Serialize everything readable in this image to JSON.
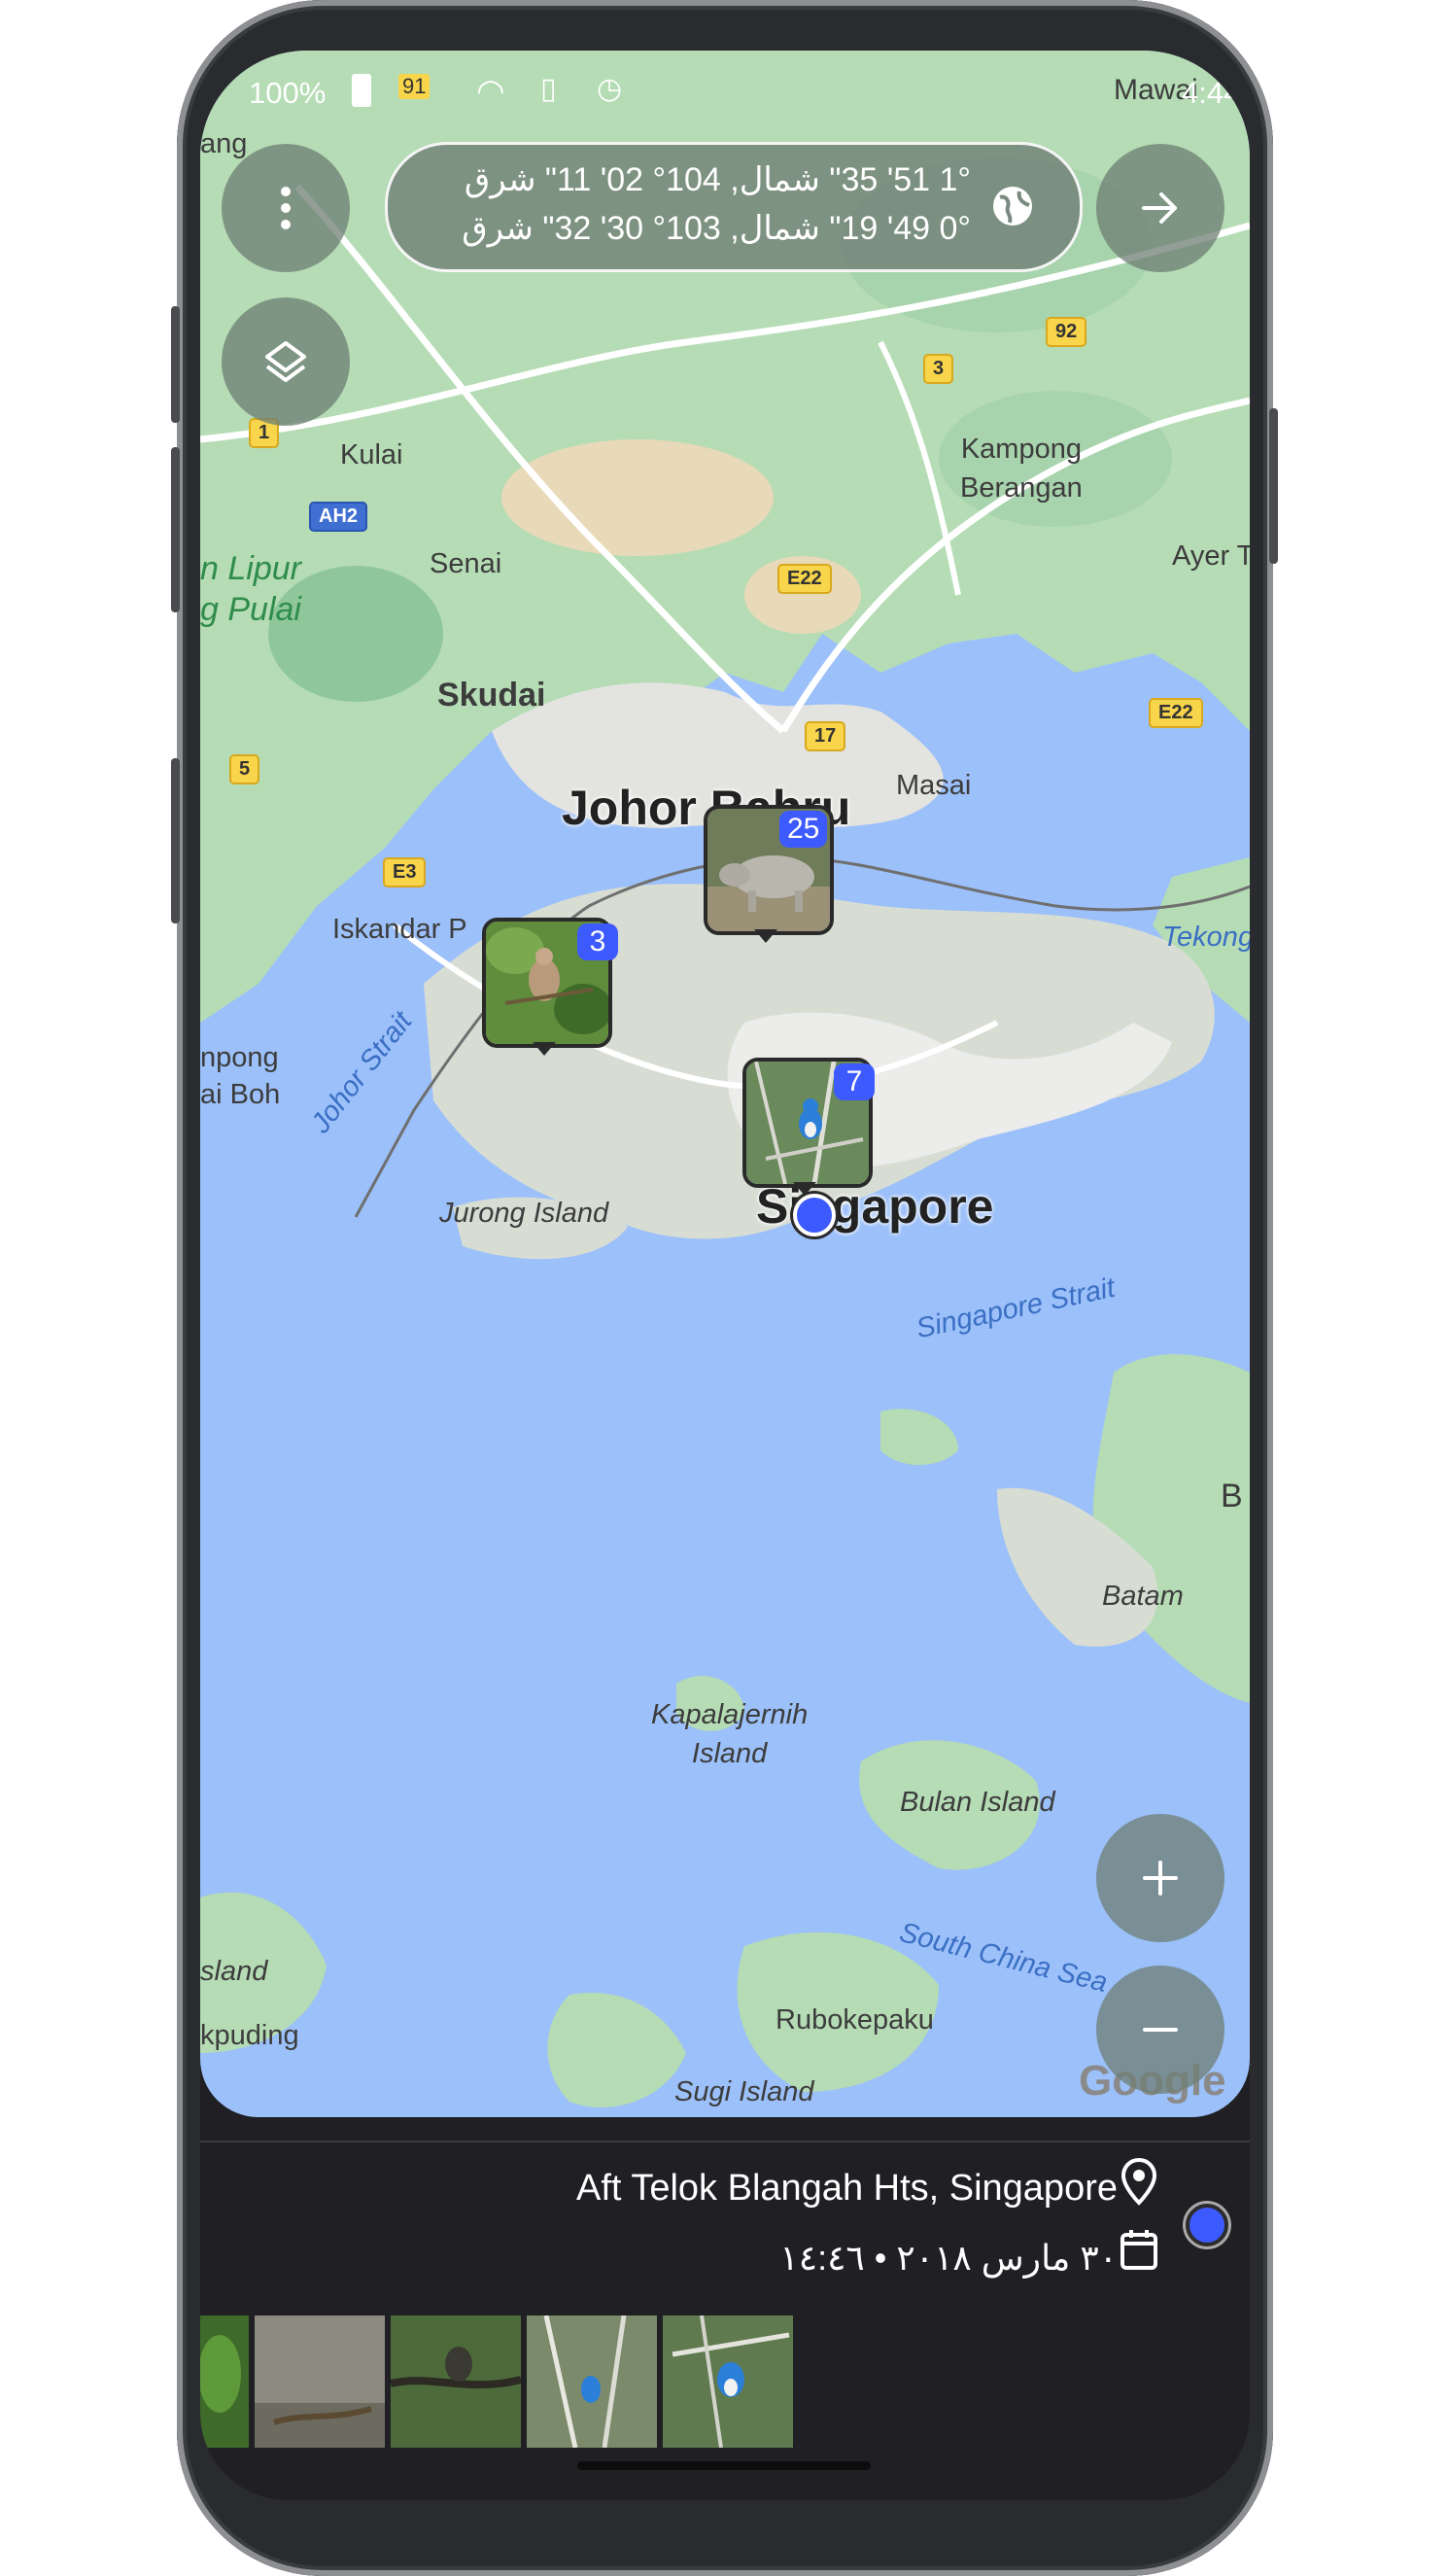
{
  "status_bar": {
    "battery_percent": "100%",
    "notification": "91",
    "time": "4:44",
    "corner_label": "Mawai"
  },
  "coordinates": {
    "line1": "1° 51' 35\" شمال, 104° 02' 11\" شرق",
    "line2": "0° 49' 19\" شمال, 103° 30' 32\" شرق"
  },
  "map_labels": {
    "kulai": "Kulai",
    "senai": "Senai",
    "skudai": "Skudai",
    "johor_bahru": "Johor Bahru",
    "iskandar": "Iskandar P",
    "masai": "Masai",
    "kampong_berangan": "Kampong\nBerangan",
    "ayer": "Ayer T",
    "tekong": "Tekong",
    "singapore": "Singapore",
    "jurong": "Jurong Island",
    "johor_strait": "Johor Strait",
    "singapore_strait": "Singapore Strait",
    "kapalajernih": "Kapalajernih\nIsland",
    "bulan": "Bulan Island",
    "batam": "Batam",
    "south_china_sea": "South China Sea",
    "rubokepaku": "Rubokepaku",
    "sugi": "Sugi Island",
    "island_left": "sland",
    "kpuding": "kpuding",
    "npong": "npong",
    "ai_boh": "ai Boh",
    "park1": "n Lipur",
    "park2": "g Pulai",
    "ang": "ang",
    "b_edge": "B",
    "google": "Google"
  },
  "road_shields": {
    "r1": "1",
    "r3": "3",
    "r5": "5",
    "r17": "17",
    "r92": "92",
    "e22a": "E22",
    "e22b": "E22",
    "e3": "E3",
    "ah2": "AH2"
  },
  "clusters": [
    {
      "count": "25",
      "subject": "rhino"
    },
    {
      "count": "3",
      "subject": "bird-on-branch"
    },
    {
      "count": "7",
      "subject": "kingfisher"
    }
  ],
  "details": {
    "address": "Aft Telok Blangah Hts, Singapore",
    "datetime": "٣٠ مارس ٢٠١٨ • ١٤:٤٦"
  },
  "icons": {
    "menu": "more-vert-icon",
    "layers": "layers-icon",
    "globe": "globe-icon",
    "next": "arrow-forward-icon",
    "zoom_in": "plus-icon",
    "zoom_out": "minus-icon",
    "pin": "location-pin-icon",
    "calendar": "calendar-icon"
  },
  "colors": {
    "water": "#9cc0f9",
    "land": "#b5dcb5",
    "accent": "#3d5afe",
    "panel": "#1f1f24"
  }
}
